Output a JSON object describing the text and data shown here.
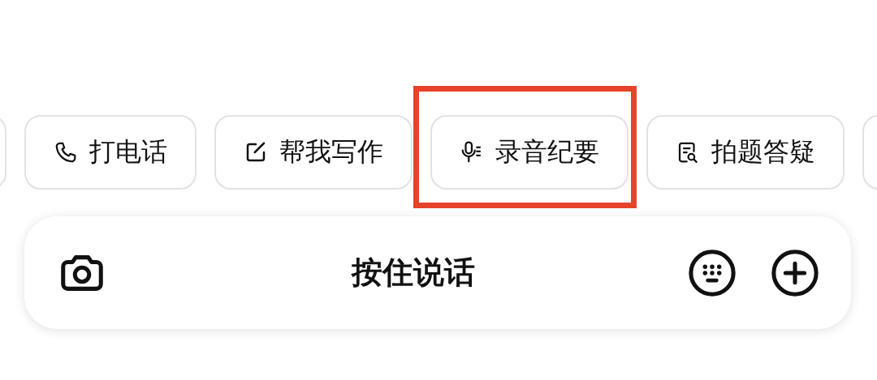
{
  "chips": [
    {
      "kind": "partial"
    },
    {
      "kind": "phone",
      "label": "打电话"
    },
    {
      "kind": "write",
      "label": "帮我写作"
    },
    {
      "kind": "record",
      "label": "录音纪要",
      "highlighted": true
    },
    {
      "kind": "scan",
      "label": "拍题答疑"
    },
    {
      "kind": "partial"
    }
  ],
  "input_bar": {
    "label": "按住说话"
  }
}
